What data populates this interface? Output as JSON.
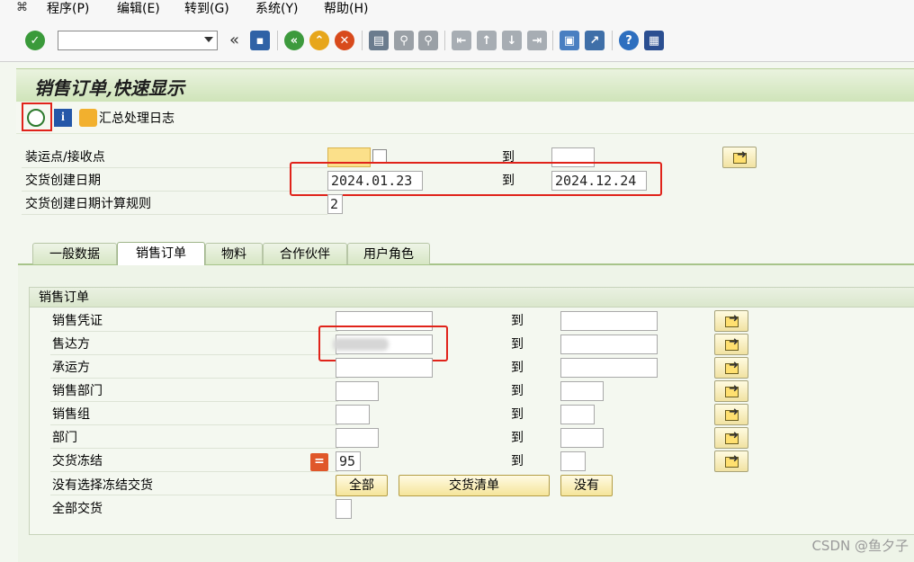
{
  "menu": {
    "items": [
      "程序(P)",
      "编辑(E)",
      "转到(G)",
      "系统(Y)",
      "帮助(H)"
    ]
  },
  "toolbar": {
    "command_value": "",
    "back_label": "«",
    "icons": [
      "check-icon",
      "save-icon",
      "back-icon",
      "exit-icon",
      "cancel-icon",
      "print-icon",
      "find-icon",
      "find-next-icon",
      "first-page-icon",
      "prev-page-icon",
      "next-page-icon",
      "last-page-icon",
      "new-session-icon",
      "shortcut-icon",
      "help-icon",
      "layout-icon"
    ]
  },
  "title": "销售订单,快速显示",
  "app_toolbar": {
    "execute_label": "",
    "info_label": "",
    "log_label": "汇总处理日志"
  },
  "header_fields": [
    {
      "label": "装运点/接收点",
      "from": "",
      "to_label": "到",
      "to": ""
    },
    {
      "label": "交货创建日期",
      "from": "2024.01.23",
      "to_label": "到",
      "to": "2024.12.24"
    },
    {
      "label": "交货创建日期计算规则",
      "from": "2"
    }
  ],
  "tabs": [
    "一般数据",
    "销售订单",
    "物料",
    "合作伙伴",
    "用户角色"
  ],
  "active_tab": "销售订单",
  "group": {
    "title": "销售订单",
    "rows": [
      {
        "label": "销售凭证",
        "from": "",
        "to_label": "到",
        "to": ""
      },
      {
        "label": "售达方",
        "from": "",
        "to_label": "到",
        "to": ""
      },
      {
        "label": "承运方",
        "from": "",
        "to_label": "到",
        "to": ""
      },
      {
        "label": "销售部门",
        "from": "",
        "to_label": "到",
        "to": ""
      },
      {
        "label": "销售组",
        "from": "",
        "to_label": "到",
        "to": ""
      },
      {
        "label": "部门",
        "from": "",
        "to_label": "到",
        "to": ""
      },
      {
        "label": "交货冻结",
        "from": "95",
        "to_label": "到",
        "to": ""
      },
      {
        "label": "没有选择冻结交货"
      },
      {
        "label": "全部交货"
      }
    ],
    "eq_symbol": "=",
    "buttons": {
      "all": "全部",
      "delivery_list": "交货清单",
      "none": "没有"
    }
  },
  "watermark": "CSDN @鱼夕子",
  "colors": {
    "highlight_box": "#e0231a",
    "required_field": "#fbe08a",
    "title_green": "#cfe4b9"
  }
}
